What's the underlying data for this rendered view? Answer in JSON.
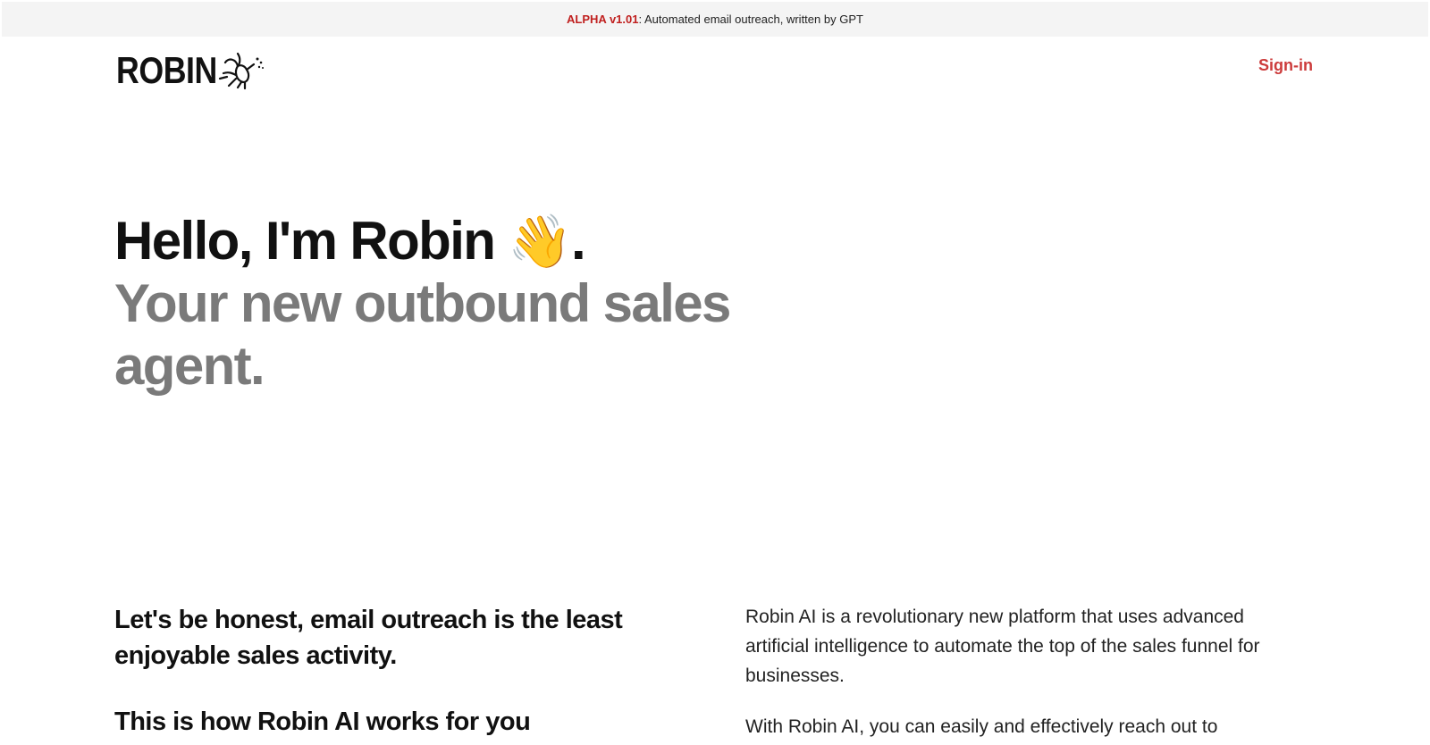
{
  "banner": {
    "tag": "ALPHA v1.01",
    "text": ": Automated email outreach, written by GPT"
  },
  "header": {
    "logo_text": "ROBIN",
    "logo_icon": "robin-bird-icon",
    "signin_label": "Sign-in"
  },
  "hero": {
    "greeting": "Hello, I'm Robin",
    "wave_emoji": "👋",
    "greeting_end": ".",
    "subtitle": "Your new outbound sales agent."
  },
  "intro": {
    "heading_1": "Let's be honest, email outreach is the least enjoyable sales activity.",
    "heading_2": "This is how Robin AI works for you",
    "paragraph_1": "Robin AI is a revolutionary new platform that uses advanced artificial intelligence to automate the top of the sales funnel for businesses.",
    "paragraph_2": "With Robin AI, you can easily and effectively reach out to"
  },
  "colors": {
    "accent": "#c0201f",
    "signin": "#cc3b3b",
    "subtitle_gray": "#7a7a7a",
    "banner_bg": "#f4f4f4"
  }
}
